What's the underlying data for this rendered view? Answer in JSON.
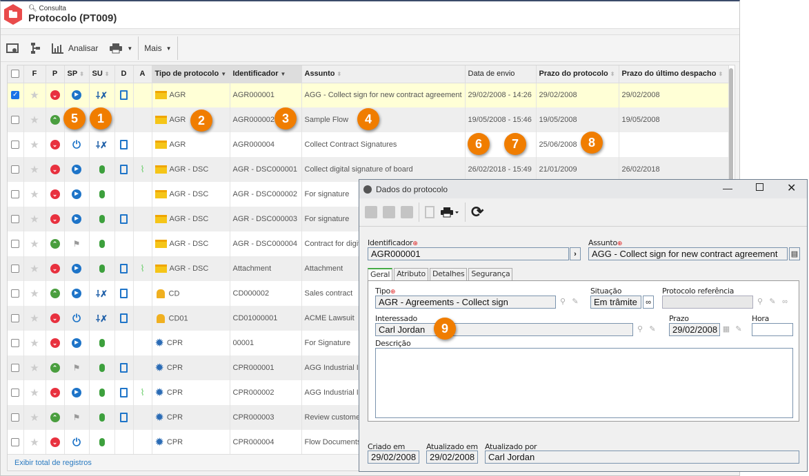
{
  "header": {
    "breadcrumb": "Consulta",
    "title": "Protocolo (PT009)"
  },
  "toolbar": {
    "analyze_label": "Analisar",
    "more_label": "Mais"
  },
  "colors": {
    "accent": "#e94b4b",
    "badge": "#f07d00",
    "selected_row": "#ffffd6",
    "link": "#2a7ac0"
  },
  "grid": {
    "columns": [
      "F",
      "P",
      "SP",
      "SU",
      "D",
      "A",
      "Tipo de protocolo",
      "Identificador",
      "Assunto",
      "Data de envio",
      "Prazo do protocolo",
      "Prazo do último despacho"
    ],
    "rows": [
      {
        "checked": true,
        "p": "down",
        "sp": "play",
        "su": "tools",
        "d": true,
        "a": false,
        "ticon": "folder",
        "tipo": "AGR",
        "id": "AGR000001",
        "assunto": "AGG - Collect sign for new contract agreement",
        "envio": "29/02/2008 - 14:26",
        "prazo": "29/02/2008",
        "ultimo": "29/02/2008"
      },
      {
        "checked": false,
        "p": "up",
        "sp": "",
        "su": "",
        "d": false,
        "a": false,
        "ticon": "folder",
        "tipo": "AGR",
        "id": "AGR000002",
        "assunto": "Sample Flow",
        "envio": "19/05/2008 - 15:46",
        "prazo": "19/05/2008",
        "ultimo": "19/05/2008"
      },
      {
        "checked": false,
        "p": "down",
        "sp": "power",
        "su": "tools",
        "d": true,
        "a": false,
        "ticon": "folder",
        "tipo": "AGR",
        "id": "AGR000004",
        "assunto": "Collect Contract Signatures",
        "envio": "",
        "prazo": "25/06/2008",
        "ultimo": ""
      },
      {
        "checked": false,
        "p": "down",
        "sp": "play",
        "su": "mouse",
        "d": true,
        "a": true,
        "ticon": "folder",
        "tipo": "AGR - DSC",
        "id": "AGR - DSC000001",
        "assunto": "Collect digital signature of board",
        "envio": "26/02/2018 - 15:49",
        "prazo": "21/01/2009",
        "ultimo": "26/02/2018"
      },
      {
        "checked": false,
        "p": "down",
        "sp": "play",
        "su": "mouse",
        "d": false,
        "a": false,
        "ticon": "folder",
        "tipo": "AGR - DSC",
        "id": "AGR - DSC000002",
        "assunto": "For signature",
        "envio": "",
        "prazo": "",
        "ultimo": ""
      },
      {
        "checked": false,
        "p": "down",
        "sp": "play",
        "su": "mouse",
        "d": true,
        "a": false,
        "ticon": "folder",
        "tipo": "AGR - DSC",
        "id": "AGR - DSC000003",
        "assunto": "For signature",
        "envio": "",
        "prazo": "",
        "ultimo": ""
      },
      {
        "checked": false,
        "p": "up",
        "sp": "flag",
        "su": "mouse",
        "d": false,
        "a": false,
        "ticon": "folder",
        "tipo": "AGR - DSC",
        "id": "AGR - DSC000004",
        "assunto": "Contract for digit",
        "envio": "",
        "prazo": "",
        "ultimo": ""
      },
      {
        "checked": false,
        "p": "down",
        "sp": "play",
        "su": "mouse",
        "d": true,
        "a": true,
        "ticon": "folder",
        "tipo": "AGR - DSC",
        "id": "Attachment",
        "assunto": "Attachment",
        "envio": "",
        "prazo": "",
        "ultimo": ""
      },
      {
        "checked": false,
        "p": "up",
        "sp": "play",
        "su": "tools",
        "d": true,
        "a": false,
        "ticon": "lock",
        "tipo": "CD",
        "id": "CD000002",
        "assunto": "Sales contract",
        "envio": "",
        "prazo": "",
        "ultimo": ""
      },
      {
        "checked": false,
        "p": "down",
        "sp": "power",
        "su": "tools",
        "d": true,
        "a": false,
        "ticon": "lock",
        "tipo": "CD01",
        "id": "CD01000001",
        "assunto": "ACME Lawsuit",
        "envio": "",
        "prazo": "",
        "ultimo": ""
      },
      {
        "checked": false,
        "p": "down",
        "sp": "play",
        "su": "mouse",
        "d": false,
        "a": false,
        "ticon": "gear",
        "tipo": "CPR",
        "id": "00001",
        "assunto": "For Signature",
        "envio": "",
        "prazo": "",
        "ultimo": ""
      },
      {
        "checked": false,
        "p": "up",
        "sp": "flag",
        "su": "mouse",
        "d": true,
        "a": false,
        "ticon": "gear",
        "tipo": "CPR",
        "id": "CPR000001",
        "assunto": "AGG Industrial I",
        "envio": "",
        "prazo": "",
        "ultimo": ""
      },
      {
        "checked": false,
        "p": "down",
        "sp": "play",
        "su": "mouse",
        "d": true,
        "a": true,
        "ticon": "gear",
        "tipo": "CPR",
        "id": "CPR000002",
        "assunto": "AGG Industrial I",
        "envio": "",
        "prazo": "",
        "ultimo": ""
      },
      {
        "checked": false,
        "p": "up",
        "sp": "flag",
        "su": "mouse",
        "d": true,
        "a": false,
        "ticon": "gear",
        "tipo": "CPR",
        "id": "CPR000003",
        "assunto": "Review custome",
        "envio": "",
        "prazo": "",
        "ultimo": ""
      },
      {
        "checked": false,
        "p": "down",
        "sp": "power",
        "su": "mouse",
        "d": false,
        "a": false,
        "ticon": "gear",
        "tipo": "CPR",
        "id": "CPR000004",
        "assunto": "Flow Documents",
        "envio": "",
        "prazo": "",
        "ultimo": ""
      }
    ],
    "footer_link": "Exibir total de registros"
  },
  "badges": [
    "1",
    "2",
    "3",
    "4",
    "5",
    "6",
    "7",
    "8",
    "9"
  ],
  "dialog": {
    "title": "Dados do protocolo",
    "identificador_label": "Identificador",
    "identificador": "AGR000001",
    "assunto_label": "Assunto",
    "assunto": "AGG - Collect sign for new contract agreement",
    "tabs": [
      "Geral",
      "Atributo",
      "Detalhes",
      "Segurança"
    ],
    "tipo_label": "Tipo",
    "tipo": "AGR - Agreements - Collect sign",
    "situacao_label": "Situação",
    "situacao": "Em trâmite",
    "ref_label": "Protocolo referência",
    "ref": "",
    "interessado_label": "Interessado",
    "interessado": "Carl Jordan",
    "prazo_label": "Prazo",
    "prazo": "29/02/2008",
    "hora_label": "Hora",
    "hora": "",
    "descricao_label": "Descrição",
    "descricao": "",
    "criado_label": "Criado em",
    "criado": "29/02/2008",
    "atualizado_label": "Atualizado em",
    "atualizado": "29/02/2008",
    "atualizado_por_label": "Atualizado por",
    "atualizado_por": "Carl Jordan"
  }
}
